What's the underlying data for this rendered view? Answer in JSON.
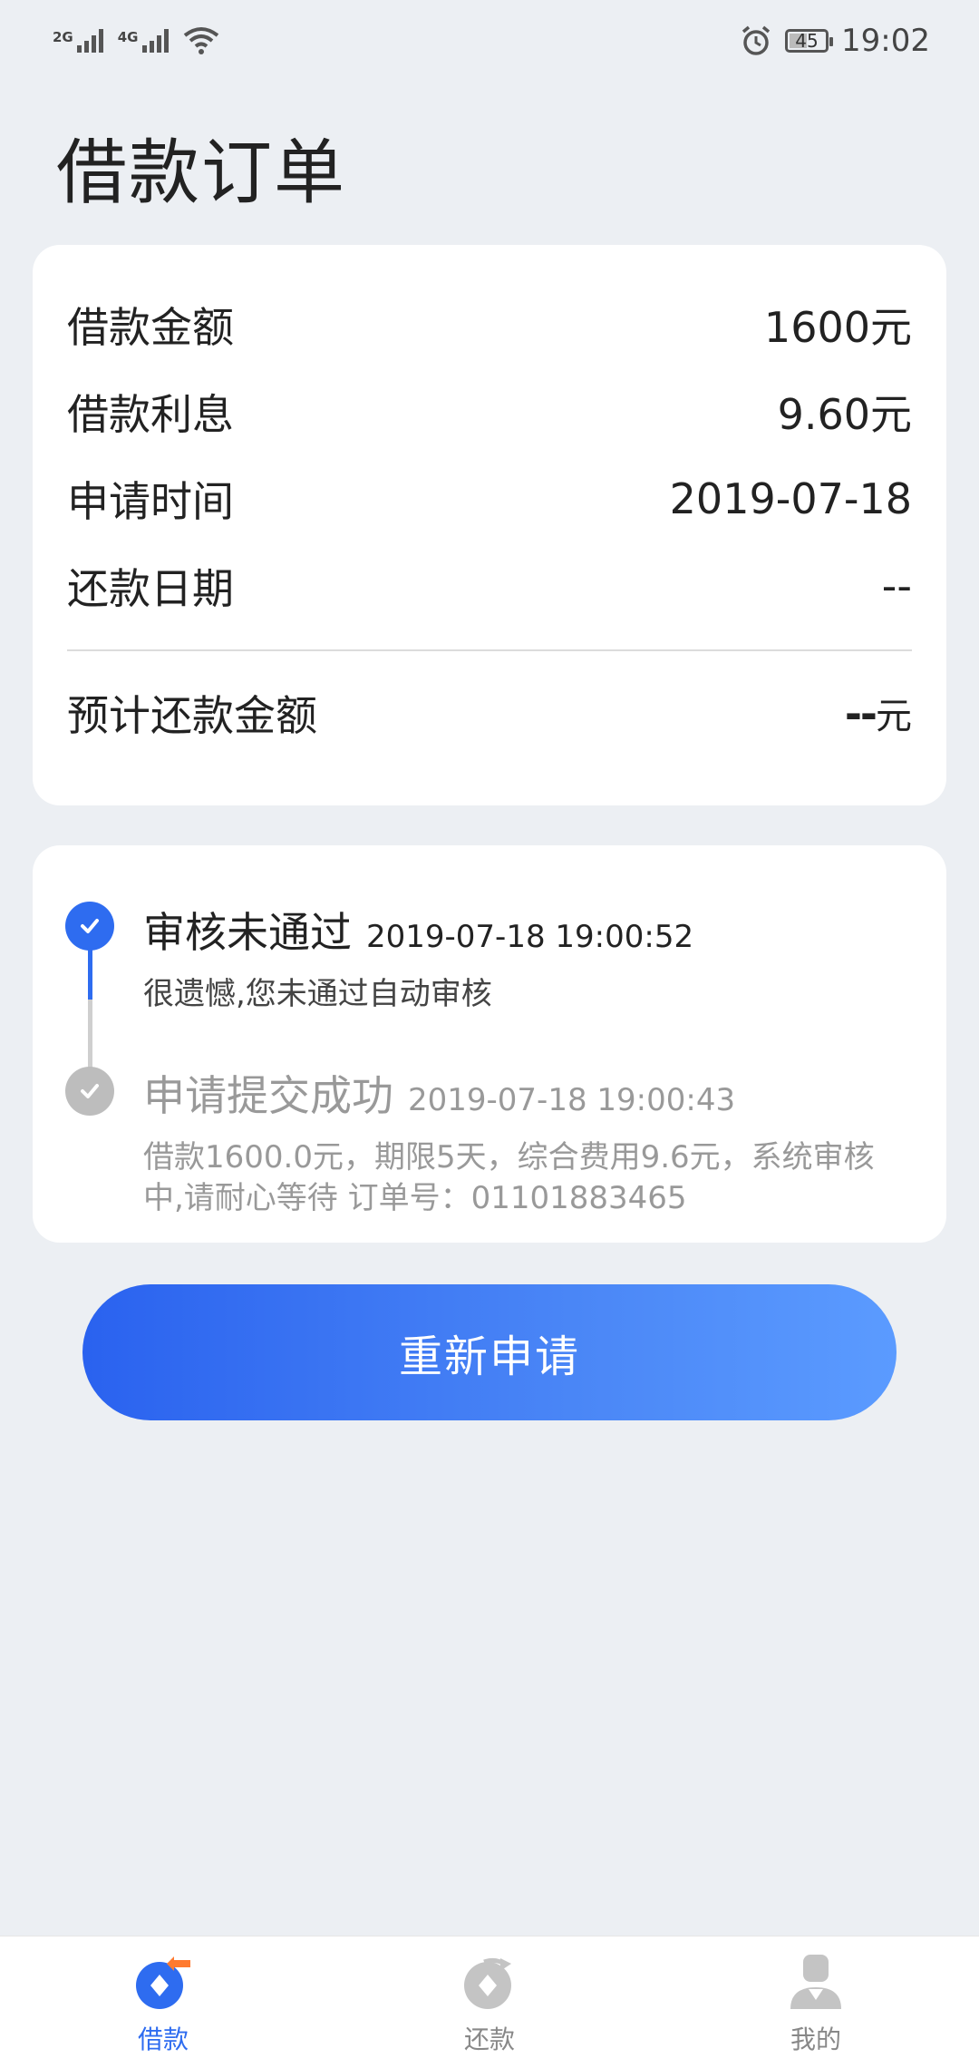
{
  "status_bar": {
    "network1": "2G",
    "network2": "4G",
    "battery": "45",
    "time": "19:02"
  },
  "page": {
    "title": "借款订单"
  },
  "order_info": {
    "rows": [
      {
        "label": "借款金额",
        "value": "1600元"
      },
      {
        "label": "借款利息",
        "value": "9.60元"
      },
      {
        "label": "申请时间",
        "value": "2019-07-18"
      },
      {
        "label": "还款日期",
        "value": "--"
      }
    ],
    "expected": {
      "label": "预计还款金额",
      "value_dash": "--",
      "value_unit": "元"
    }
  },
  "timeline": {
    "items": [
      {
        "title": "审核未通过",
        "time": "2019-07-18 19:00:52",
        "desc": "很遗憾,您未通过自动审核"
      },
      {
        "title": "申请提交成功",
        "time": "2019-07-18 19:00:43",
        "desc": "借款1600.0元，期限5天，综合费用9.6元，系统审核中,请耐心等待 订单号：01101883465"
      }
    ]
  },
  "actions": {
    "reapply_label": "重新申请"
  },
  "tabbar": {
    "items": [
      {
        "label": "借款",
        "icon": "loan-icon"
      },
      {
        "label": "还款",
        "icon": "repay-icon"
      },
      {
        "label": "我的",
        "icon": "profile-icon"
      }
    ]
  },
  "colors": {
    "accent": "#2e6cf0",
    "background": "#eceff3",
    "inactive": "#bdbdbd"
  }
}
